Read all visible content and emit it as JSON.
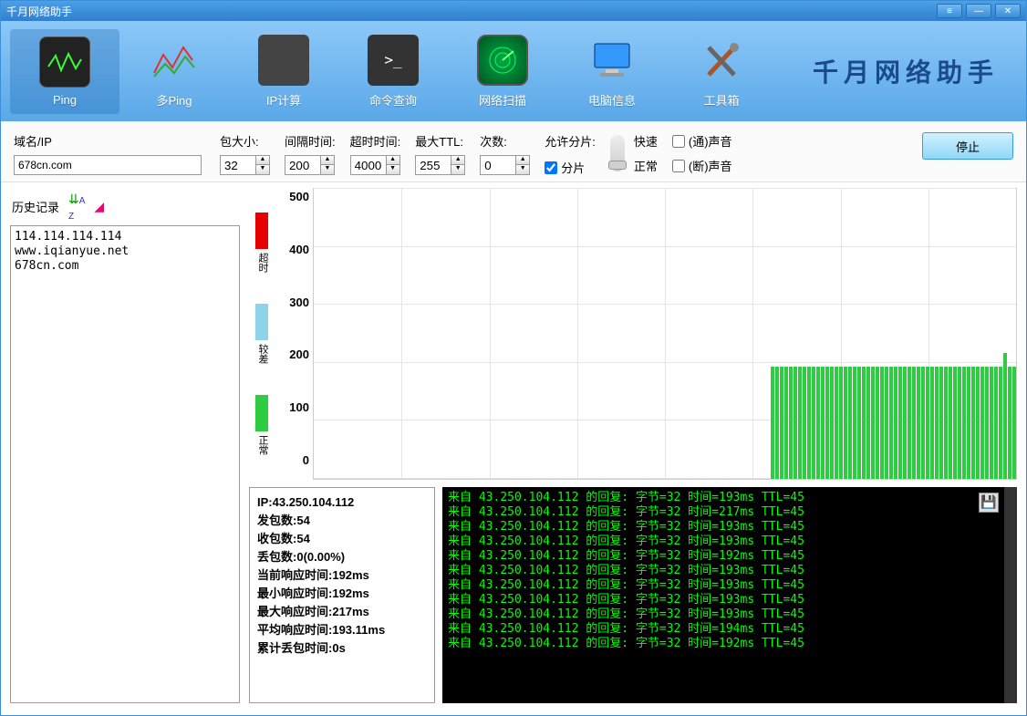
{
  "window": {
    "title": "千月网络助手"
  },
  "toolbar": {
    "items": [
      {
        "label": "Ping"
      },
      {
        "label": "多Ping"
      },
      {
        "label": "IP计算"
      },
      {
        "label": "命令查询"
      },
      {
        "label": "网络扫描"
      },
      {
        "label": "电脑信息"
      },
      {
        "label": "工具箱"
      }
    ],
    "brand": "千月网络助手"
  },
  "params": {
    "domain_label": "域名/IP",
    "domain_value": "678cn.com",
    "pkt_size_label": "包大小:",
    "pkt_size_value": "32",
    "interval_label": "间隔时间:",
    "interval_value": "200",
    "timeout_label": "超时时间:",
    "timeout_value": "4000",
    "maxttl_label": "最大TTL:",
    "maxttl_value": "255",
    "count_label": "次数:",
    "count_value": "0",
    "frag_label": "允许分片:",
    "frag_check_label": "分片",
    "speed_fast": "快速",
    "speed_normal": "正常",
    "sound_pass": "(通)声音",
    "sound_fail": "(断)声音",
    "stop_btn": "停止"
  },
  "history": {
    "label": "历史记录",
    "items": [
      "114.114.114.114",
      "www.iqianyue.net",
      "678cn.com"
    ]
  },
  "chart_data": {
    "type": "bar",
    "ylabel": "",
    "ylim": [
      0,
      500
    ],
    "yticks": [
      0,
      100,
      200,
      300,
      400,
      500
    ],
    "legend": [
      {
        "name": "超时",
        "color": "#e60000"
      },
      {
        "name": "较差",
        "color": "#8fd3e8"
      },
      {
        "name": "正常",
        "color": "#2ecc40"
      }
    ],
    "values": [
      193,
      193,
      193,
      193,
      193,
      193,
      193,
      193,
      193,
      193,
      193,
      193,
      193,
      193,
      193,
      193,
      193,
      193,
      193,
      193,
      193,
      193,
      193,
      193,
      193,
      193,
      193,
      193,
      193,
      193,
      193,
      193,
      193,
      193,
      193,
      193,
      193,
      193,
      193,
      193,
      193,
      193,
      193,
      193,
      193,
      193,
      193,
      193,
      193,
      193,
      193,
      217,
      193,
      193
    ]
  },
  "stats": {
    "ip_label": "IP:",
    "ip": "43.250.104.112",
    "sent_label": "发包数:",
    "sent": "54",
    "recv_label": "收包数:",
    "recv": "54",
    "lost_label": "丢包数:",
    "lost": "0(0.00%)",
    "cur_label": "当前响应时间:",
    "cur": "192ms",
    "min_label": "最小响应时间:",
    "min": "192ms",
    "max_label": "最大响应时间:",
    "max": "217ms",
    "avg_label": "平均响应时间:",
    "avg": "193.11ms",
    "losttime_label": "累计丢包时间:",
    "losttime": "0s"
  },
  "console": {
    "lines": [
      "来自 43.250.104.112 的回复: 字节=32 时间=193ms TTL=45",
      "来自 43.250.104.112 的回复: 字节=32 时间=217ms TTL=45",
      "来自 43.250.104.112 的回复: 字节=32 时间=193ms TTL=45",
      "来自 43.250.104.112 的回复: 字节=32 时间=193ms TTL=45",
      "来自 43.250.104.112 的回复: 字节=32 时间=192ms TTL=45",
      "来自 43.250.104.112 的回复: 字节=32 时间=193ms TTL=45",
      "来自 43.250.104.112 的回复: 字节=32 时间=193ms TTL=45",
      "来自 43.250.104.112 的回复: 字节=32 时间=193ms TTL=45",
      "来自 43.250.104.112 的回复: 字节=32 时间=193ms TTL=45",
      "来自 43.250.104.112 的回复: 字节=32 时间=194ms TTL=45",
      "来自 43.250.104.112 的回复: 字节=32 时间=192ms TTL=45"
    ]
  }
}
